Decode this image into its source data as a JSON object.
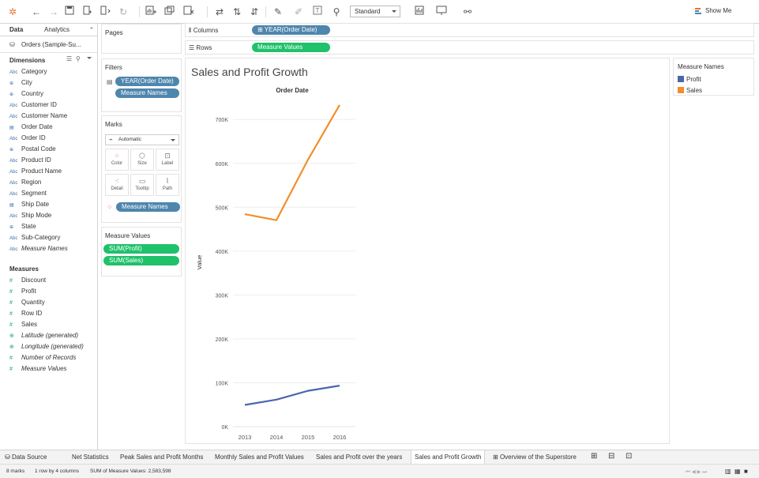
{
  "toolbar": {
    "view_mode": "Standard",
    "show_me": "Show Me"
  },
  "data_pane": {
    "tabs": [
      "Data",
      "Analytics"
    ],
    "datasource": "Orders (Sample-Su...",
    "dimensions_header": "Dimensions",
    "dimensions": [
      {
        "type": "Abc",
        "name": "Category"
      },
      {
        "type": "geo",
        "name": "City"
      },
      {
        "type": "geo",
        "name": "Country"
      },
      {
        "type": "Abc",
        "name": "Customer ID"
      },
      {
        "type": "Abc",
        "name": "Customer Name"
      },
      {
        "type": "date",
        "name": "Order Date"
      },
      {
        "type": "Abc",
        "name": "Order ID"
      },
      {
        "type": "geo",
        "name": "Postal Code"
      },
      {
        "type": "Abc",
        "name": "Product ID"
      },
      {
        "type": "Abc",
        "name": "Product Name"
      },
      {
        "type": "Abc",
        "name": "Region"
      },
      {
        "type": "Abc",
        "name": "Segment"
      },
      {
        "type": "date",
        "name": "Ship Date"
      },
      {
        "type": "Abc",
        "name": "Ship Mode"
      },
      {
        "type": "geo",
        "name": "State"
      },
      {
        "type": "Abc",
        "name": "Sub-Category"
      },
      {
        "type": "Abc",
        "name": "Measure Names"
      }
    ],
    "measures_header": "Measures",
    "measures": [
      {
        "type": "num",
        "name": "Discount"
      },
      {
        "type": "num",
        "name": "Profit"
      },
      {
        "type": "num",
        "name": "Quantity"
      },
      {
        "type": "num",
        "name": "Row ID"
      },
      {
        "type": "num",
        "name": "Sales"
      },
      {
        "type": "geo",
        "name": "Latitude (generated)"
      },
      {
        "type": "geo",
        "name": "Longitude (generated)"
      },
      {
        "type": "num",
        "name": "Number of Records"
      },
      {
        "type": "num",
        "name": "Measure Values"
      }
    ]
  },
  "cards": {
    "pages": "Pages",
    "filters": "Filters",
    "filter_pills": [
      "YEAR(Order Date)",
      "Measure Names"
    ],
    "marks": "Marks",
    "mark_type": "Automatic",
    "mark_buttons": [
      "Color",
      "Size",
      "Label",
      "Detail",
      "Tooltip",
      "Path"
    ],
    "marks_pill": "Measure Names",
    "measure_values": "Measure Values",
    "measure_value_pills": [
      "SUM(Profit)",
      "SUM(Sales)"
    ]
  },
  "shelves": {
    "columns_label": "Columns",
    "columns_pill": "YEAR(Order Date)",
    "rows_label": "Rows",
    "rows_pill": "Measure Values"
  },
  "legend": {
    "title": "Measure Names",
    "items": [
      {
        "name": "Profit",
        "color": "#4a66ac"
      },
      {
        "name": "Sales",
        "color": "#f28e2b"
      }
    ]
  },
  "chart_data": {
    "type": "line",
    "title": "Sales and Profit Growth",
    "header": "Order Date",
    "ylabel": "Value",
    "x": [
      "2013",
      "2014",
      "2015",
      "2016"
    ],
    "ylim": [
      0,
      740000
    ],
    "yticks": [
      0,
      100000,
      200000,
      300000,
      400000,
      500000,
      600000,
      700000
    ],
    "ytick_labels": [
      "0K",
      "100K",
      "200K",
      "300K",
      "400K",
      "500K",
      "600K",
      "700K"
    ],
    "grid": true,
    "series": [
      {
        "name": "Profit",
        "color": "#4a66ac",
        "values": [
          49500,
          61600,
          81700,
          93400
        ]
      },
      {
        "name": "Sales",
        "color": "#f28e2b",
        "values": [
          484200,
          470500,
          608500,
          733200
        ]
      }
    ]
  },
  "sheet_tabs": [
    "Data Source",
    "Net Statistics",
    "Peak Sales and Profit Months",
    "Monthly Sales and Profit Values",
    "Sales and Profit over the years",
    "Sales and Profit Growth",
    "Overview of the Superstore"
  ],
  "active_tab": "Sales and Profit Growth",
  "status": {
    "marks": "8 marks",
    "rows": "1 row by 4 columns",
    "sum": "SUM of Measure Values: 2,583,598"
  }
}
